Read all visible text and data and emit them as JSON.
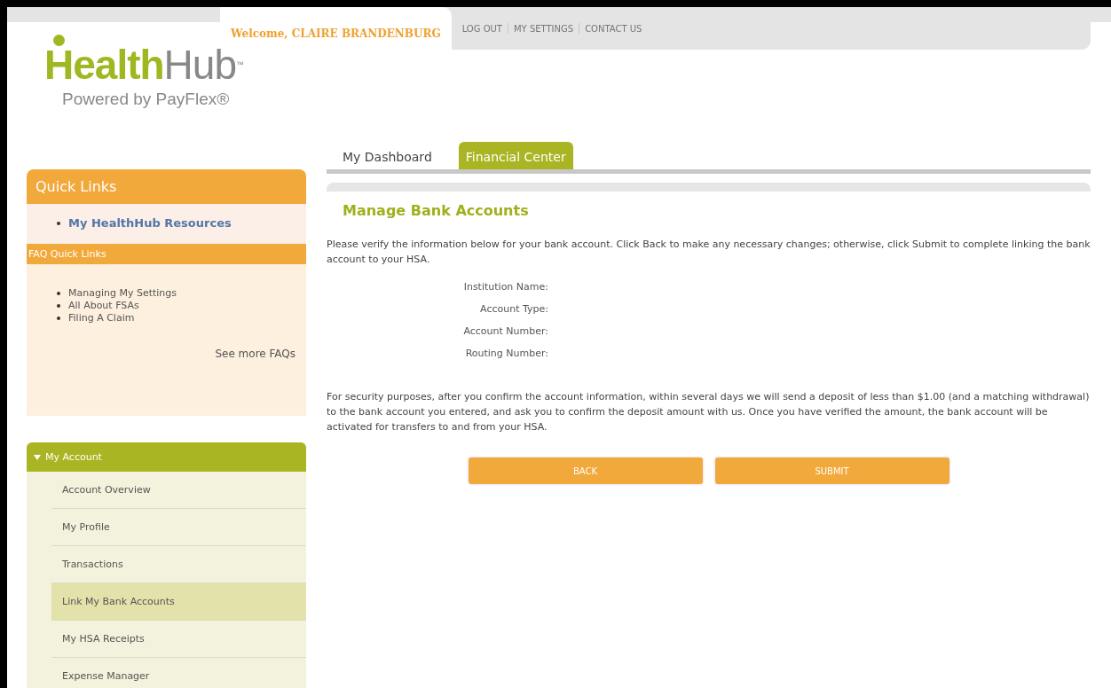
{
  "header": {
    "welcome": "Welcome, CLAIRE BRANDENBURG",
    "links": [
      "LOG OUT",
      "MY SETTINGS",
      "CONTACT US"
    ]
  },
  "logo": {
    "first": "Health",
    "second": "Hub",
    "mark": "™",
    "tagline": "Powered by PayFlex®"
  },
  "quick_links": {
    "title": "Quick Links",
    "items": [
      "My HealthHub Resources"
    ]
  },
  "faq": {
    "title": "FAQ Quick Links",
    "items": [
      "Managing My Settings",
      "All About FSAs",
      "Filing A Claim"
    ],
    "more": "See more FAQs"
  },
  "account_menu": {
    "title": "My Account",
    "expanded": true,
    "items": [
      {
        "label": "Account Overview",
        "selected": false
      },
      {
        "label": "My Profile",
        "selected": false
      },
      {
        "label": "Transactions",
        "selected": false
      },
      {
        "label": "Link My Bank Accounts",
        "selected": true
      },
      {
        "label": "My HSA Receipts",
        "selected": false
      },
      {
        "label": "Expense Manager",
        "selected": false
      }
    ]
  },
  "tabs": [
    {
      "label": "My Dashboard",
      "selected": false
    },
    {
      "label": "Financial Center",
      "selected": true
    }
  ],
  "page": {
    "title": "Manage Bank Accounts",
    "intro": "Please verify the information below for your bank account. Click Back to make any necessary changes; otherwise, click Submit to complete linking the bank account to your HSA.",
    "fields": [
      "Institution Name:",
      "Account Type:",
      "Account Number:",
      "Routing Number:"
    ],
    "notice": "For security purposes, after you confirm the account information, within several days we will send a deposit of less than $1.00 (and a matching withdrawal) to the bank account you entered, and ask you to confirm the deposit amount with us. Once you have verified the amount, the bank account will be activated for transfers to and from your HSA.",
    "buttons": [
      "BACK",
      "SUBMIT"
    ]
  }
}
